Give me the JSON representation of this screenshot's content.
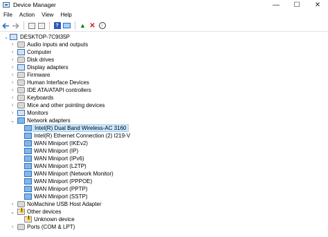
{
  "window": {
    "title": "Device Manager",
    "controls": {
      "minimize": "—",
      "maximize": "☐",
      "close": "✕"
    }
  },
  "menu": [
    "File",
    "Action",
    "View",
    "Help"
  ],
  "toolbar": {
    "icons": [
      "back-arrow-icon",
      "forward-arrow-icon",
      "properties-icon",
      "show-hide-icon",
      "help-icon",
      "monitor-icon",
      "add-driver-icon",
      "uninstall-icon",
      "download-icon"
    ]
  },
  "tree": {
    "root": "DESKTOP-7C9I35P",
    "categories": [
      "Audio inputs and outputs",
      "Computer",
      "Disk drives",
      "Display adapters",
      "Firmware",
      "Human Interface Devices",
      "IDE ATA/ATAPI controllers",
      "Keyboards",
      "Mice and other pointing devices",
      "Monitors",
      "Network adapters"
    ],
    "network_adapters": [
      "Intel(R) Dual Band Wireless-AC 3160",
      "Intel(R) Ethernet Connection (2) I219-V",
      "WAN Miniport (IKEv2)",
      "WAN Miniport (IP)",
      "WAN Miniport (IPv6)",
      "WAN Miniport (L2TP)",
      "WAN Miniport (Network Monitor)",
      "WAN Miniport (PPPOE)",
      "WAN Miniport (PPTP)",
      "WAN Miniport (SSTP)"
    ],
    "after": [
      "NoMachine USB Host Adapter",
      "Other devices"
    ],
    "other_devices": [
      "Unknown device"
    ],
    "cut_off": "Ports (COM & LPT)",
    "selected": "Intel(R) Dual Band Wireless-AC 3160"
  }
}
